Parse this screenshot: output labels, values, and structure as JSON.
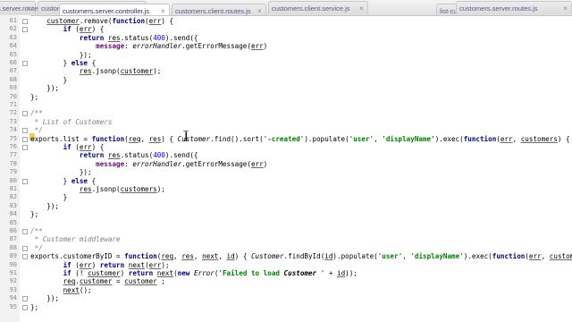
{
  "tabs": [
    {
      "name": "customers.server.routes.js",
      "active": false
    },
    {
      "name": "customers.client.controller.js",
      "active": false
    },
    {
      "name": "customers.server.controller.js",
      "active": true
    },
    {
      "name": "customers.client.routes.js",
      "active": false
    },
    {
      "name": "customers.client.service.js",
      "active": false
    },
    {
      "name": "list-customers.client.view.html",
      "active": false
    },
    {
      "name": "customers.server.routes.js",
      "active": false
    }
  ],
  "tab_close_glyph": "×",
  "lines": [
    {
      "n": "61",
      "text": "    customer.remove(function(err) {"
    },
    {
      "n": "62",
      "text": "        if (err) {"
    },
    {
      "n": "63",
      "text": "            return res.status(400).send({"
    },
    {
      "n": "64",
      "text": "                message: errorHandler.getErrorMessage(err)"
    },
    {
      "n": "65",
      "text": "            });"
    },
    {
      "n": "66",
      "text": "        } else {"
    },
    {
      "n": "67",
      "text": "            res.jsonp(customer);"
    },
    {
      "n": "68",
      "text": "        }"
    },
    {
      "n": "69",
      "text": "    });"
    },
    {
      "n": "70",
      "text": "};"
    },
    {
      "n": "71",
      "text": ""
    },
    {
      "n": "72",
      "text": "/**"
    },
    {
      "n": "73",
      "text": " * List of Customers"
    },
    {
      "n": "74",
      "text": " */"
    },
    {
      "n": "75",
      "text": "exports.list = function(req, res) { Customer.find().sort('-created').populate('user', 'displayName').exec(function(err, customers) {"
    },
    {
      "n": "76",
      "text": "        if (err) {"
    },
    {
      "n": "77",
      "text": "            return res.status(400).send({"
    },
    {
      "n": "78",
      "text": "                message: errorHandler.getErrorMessage(err)"
    },
    {
      "n": "79",
      "text": "            });"
    },
    {
      "n": "80",
      "text": "        } else {"
    },
    {
      "n": "81",
      "text": "            res.jsonp(customers);"
    },
    {
      "n": "82",
      "text": "        }"
    },
    {
      "n": "83",
      "text": "    });"
    },
    {
      "n": "84",
      "text": "};"
    },
    {
      "n": "85",
      "text": ""
    },
    {
      "n": "86",
      "text": "/**"
    },
    {
      "n": "87",
      "text": " * Customer middleware"
    },
    {
      "n": "88",
      "text": " */"
    },
    {
      "n": "89",
      "text": "exports.customerByID = function(req, res, next, id) { Customer.findById(id).populate('user', 'displayName').exec(function(err, customer)"
    },
    {
      "n": "90",
      "text": "        if (err) return next(err);"
    },
    {
      "n": "91",
      "text": "        if (! customer) return next(new Error('Failed to load Customer ' + id));"
    },
    {
      "n": "92",
      "text": "        req.customer = customer ;"
    },
    {
      "n": "93",
      "text": "        next();"
    },
    {
      "n": "94",
      "text": "    });"
    },
    {
      "n": "95",
      "text": "};"
    }
  ]
}
